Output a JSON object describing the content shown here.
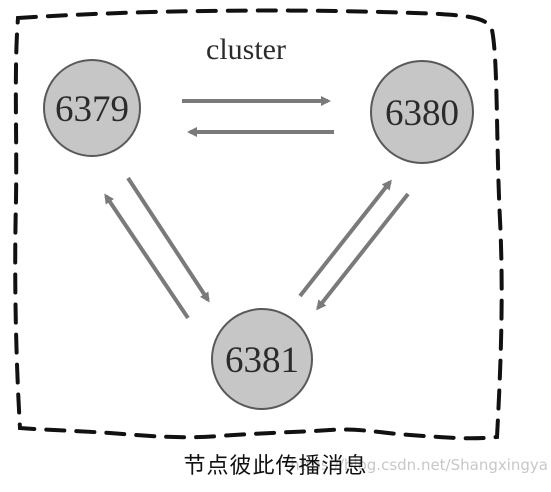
{
  "cluster": {
    "label": "cluster"
  },
  "nodes": [
    {
      "id": "n6379",
      "label": "6379"
    },
    {
      "id": "n6380",
      "label": "6380"
    },
    {
      "id": "n6381",
      "label": "6381"
    }
  ],
  "caption": "节点彼此传播消息",
  "watermark": "https://blog.csdn.net/Shangxingya",
  "colors": {
    "node_fill": "#c6c6c6",
    "node_stroke": "#595959",
    "arrow": "#7a7a7a",
    "border": "#111111"
  }
}
